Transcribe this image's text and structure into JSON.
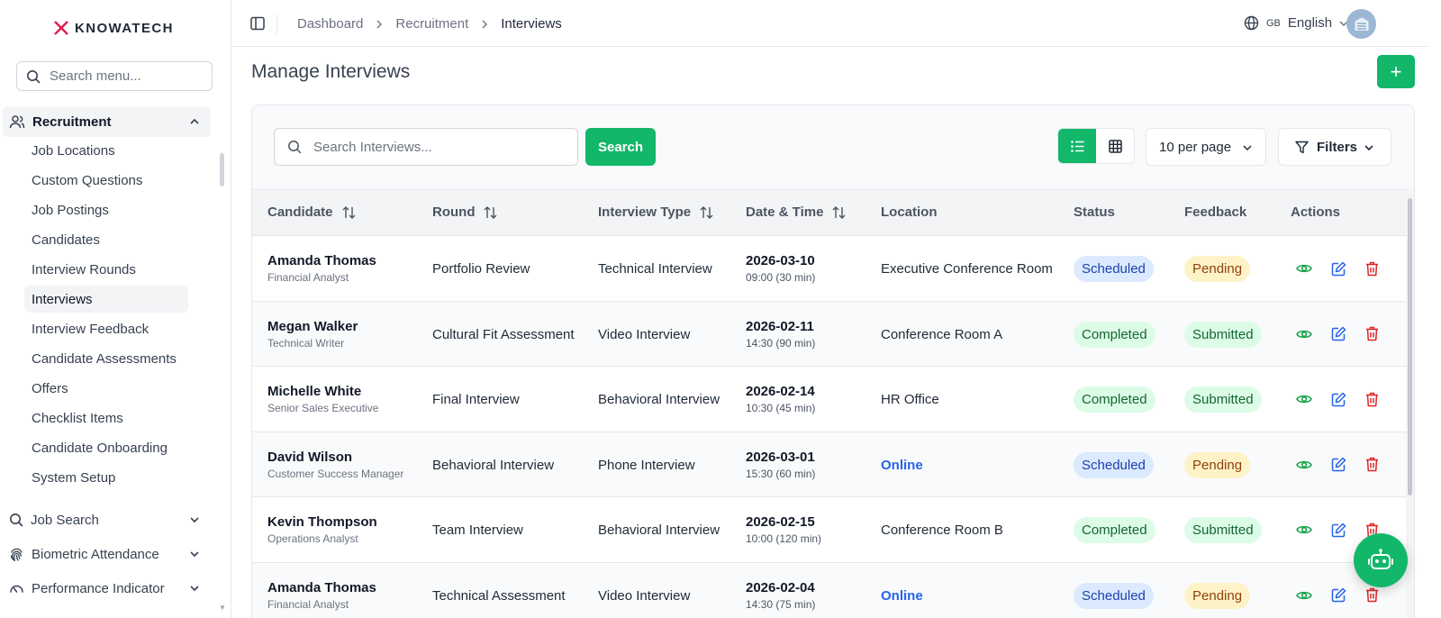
{
  "brand": {
    "name": "KNOWATECH",
    "accent": "#12b76a"
  },
  "sidebar": {
    "search_placeholder": "Search menu...",
    "sections": [
      {
        "label": "Recruitment",
        "icon": "users-icon",
        "expanded": true
      },
      {
        "label": "Job Search",
        "icon": "search-icon",
        "expanded": false
      },
      {
        "label": "Biometric Attendance",
        "icon": "fingerprint-icon",
        "expanded": false
      },
      {
        "label": "Performance Indicator",
        "icon": "gauge-icon",
        "expanded": false
      }
    ],
    "recruitment_items": [
      {
        "label": "Job Locations"
      },
      {
        "label": "Custom Questions"
      },
      {
        "label": "Job Postings"
      },
      {
        "label": "Candidates"
      },
      {
        "label": "Interview Rounds"
      },
      {
        "label": "Interviews",
        "active": true
      },
      {
        "label": "Interview Feedback"
      },
      {
        "label": "Candidate Assessments"
      },
      {
        "label": "Offers"
      },
      {
        "label": "Checklist Items"
      },
      {
        "label": "Candidate Onboarding"
      },
      {
        "label": "System Setup"
      }
    ]
  },
  "header": {
    "breadcrumb": [
      "Dashboard",
      "Recruitment",
      "Interviews"
    ],
    "language_code": "GB",
    "language": "English"
  },
  "page": {
    "title": "Manage Interviews",
    "add_label": "+",
    "search_placeholder": "Search Interviews...",
    "search_button": "Search",
    "per_page": "10 per page",
    "filters": "Filters"
  },
  "table": {
    "columns": [
      "Candidate",
      "Round",
      "Interview Type",
      "Date & Time",
      "Location",
      "Status",
      "Feedback",
      "Actions"
    ],
    "rows": [
      {
        "name": "Amanda Thomas",
        "role": "Financial Analyst",
        "round": "Portfolio Review",
        "type": "Technical Interview",
        "date": "2026-03-10",
        "time": "09:00 (30 min)",
        "location": "Executive Conference Room",
        "online": false,
        "status": "Scheduled",
        "feedback": "Pending"
      },
      {
        "name": "Megan Walker",
        "role": "Technical Writer",
        "round": "Cultural Fit Assessment",
        "type": "Video Interview",
        "date": "2026-02-11",
        "time": "14:30 (90 min)",
        "location": "Conference Room A",
        "online": false,
        "status": "Completed",
        "feedback": "Submitted"
      },
      {
        "name": "Michelle White",
        "role": "Senior Sales Executive",
        "round": "Final Interview",
        "type": "Behavioral Interview",
        "date": "2026-02-14",
        "time": "10:30 (45 min)",
        "location": "HR Office",
        "online": false,
        "status": "Completed",
        "feedback": "Submitted"
      },
      {
        "name": "David Wilson",
        "role": "Customer Success Manager",
        "round": "Behavioral Interview",
        "type": "Phone Interview",
        "date": "2026-03-01",
        "time": "15:30 (60 min)",
        "location": "Online",
        "online": true,
        "status": "Scheduled",
        "feedback": "Pending"
      },
      {
        "name": "Kevin Thompson",
        "role": "Operations Analyst",
        "round": "Team Interview",
        "type": "Behavioral Interview",
        "date": "2026-02-15",
        "time": "10:00 (120 min)",
        "location": "Conference Room B",
        "online": false,
        "status": "Completed",
        "feedback": "Submitted"
      },
      {
        "name": "Amanda Thomas",
        "role": "Financial Analyst",
        "round": "Technical Assessment",
        "type": "Video Interview",
        "date": "2026-02-04",
        "time": "14:30 (75 min)",
        "location": "Online",
        "online": true,
        "status": "Scheduled",
        "feedback": "Pending"
      }
    ]
  }
}
